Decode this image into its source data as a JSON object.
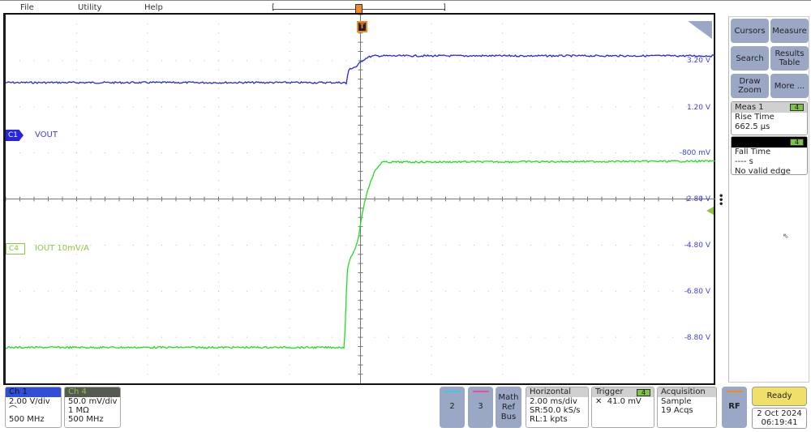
{
  "menu": {
    "file": "File",
    "utility": "Utility",
    "help": "Help"
  },
  "trigger_marker": "T",
  "colors": {
    "ch1": "#2626e0",
    "ch4": "#22dd22",
    "ch4_label": "#8cc63f",
    "trigger": "#f08a24",
    "button": "#9aa8c6",
    "ready": "#f0e068"
  },
  "channels": {
    "c1": {
      "tag": "C1",
      "name": "VOUT"
    },
    "c4": {
      "tag": "C4",
      "name": "IOUT 10mV/A"
    }
  },
  "y_axis_labels": [
    "3.20 V",
    "1.20 V",
    "-800 mV",
    "-2.80 V",
    "-4.80 V",
    "-6.80 V",
    "-8.80 V"
  ],
  "side_panel": {
    "buttons": [
      "Cursors",
      "Measure",
      "Search",
      "Results Table",
      "Draw Zoom",
      "More ..."
    ],
    "meas1": {
      "title": "Meas 1",
      "source": "4",
      "type": "Rise Time",
      "value": "662.5 µs"
    },
    "meas2": {
      "title": "",
      "source": "4",
      "type": "Fall Time",
      "value": "---- s",
      "note": "No valid edge"
    }
  },
  "bottom": {
    "ch1": {
      "title": "Ch 1",
      "scale": "2.00 V/div",
      "coupling_icon": "probe-icon",
      "bw": "500 MHz"
    },
    "ch4": {
      "title": "Ch 4",
      "scale": "50.0 mV/div",
      "impedance": "1 MΩ",
      "bw": "500 MHz"
    },
    "ch2": "2",
    "ch3": "3",
    "math": "Math Ref Bus",
    "horizontal": {
      "title": "Horizontal",
      "scale": "2.00 ms/div",
      "sr": "SR:50.0 kS/s",
      "rl": "RL:1 kpts"
    },
    "trigger": {
      "title": "Trigger",
      "source": "4",
      "level": "41.0 mV",
      "slope_icon": "edge-either-icon"
    },
    "acquisition": {
      "title": "Acquisition",
      "mode": "Sample",
      "count": "19 Acqs"
    },
    "rf": "RF",
    "status": "Ready",
    "date": "2 Oct 2024",
    "time": "06:19:41"
  },
  "chart_data": {
    "type": "line",
    "x_unit": "ms",
    "xlim": [
      -10,
      10
    ],
    "x_divisions": 10,
    "grid": true,
    "series": [
      {
        "name": "VOUT",
        "channel": "C1",
        "unit": "V",
        "ylim": [
          -10.8,
          5.2
        ],
        "x": [
          -10,
          -0.45,
          -0.4,
          -0.35,
          -0.3,
          -0.1,
          0,
          0.2,
          0.4,
          10
        ],
        "y": [
          2.25,
          2.25,
          2.2,
          2.7,
          2.85,
          2.95,
          3.15,
          3.35,
          3.41,
          3.41
        ]
      },
      {
        "name": "IOUT 10mV/A",
        "channel": "C4",
        "unit": "mV",
        "ylim": [
          -175,
          225
        ],
        "x": [
          -10,
          -0.45,
          -0.42,
          -0.38,
          -0.3,
          -0.15,
          -0.05,
          0.05,
          0.2,
          0.4,
          0.6,
          10
        ],
        "y": [
          -136,
          -136,
          -100,
          -55,
          -40,
          -30,
          -15,
          10,
          35,
          55,
          65,
          66
        ]
      }
    ]
  }
}
